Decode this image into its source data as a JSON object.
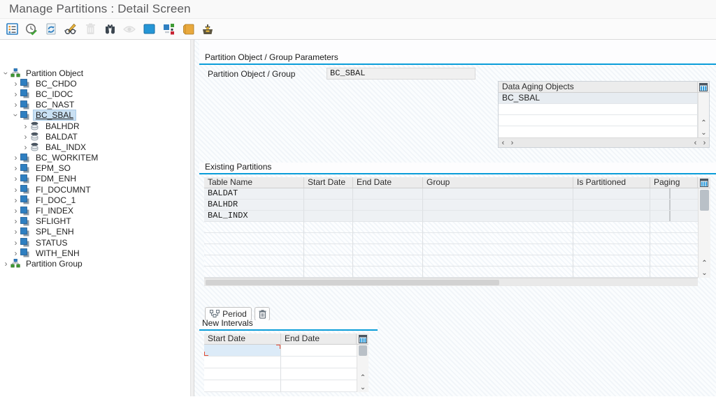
{
  "window": {
    "title": "Manage Partitions : Detail Screen"
  },
  "toolbar": {
    "icons": [
      "detail-list",
      "schedule-check",
      "refresh",
      "display-change",
      "delete",
      "find",
      "preview",
      "block",
      "legend",
      "note",
      "import"
    ]
  },
  "tree": {
    "items": [
      {
        "label": "Partition Object",
        "level": 0,
        "expanded": true
      },
      {
        "label": "BC_CHDO",
        "level": 1
      },
      {
        "label": "BC_IDOC",
        "level": 1
      },
      {
        "label": "BC_NAST",
        "level": 1
      },
      {
        "label": "BC_SBAL",
        "level": 1,
        "expanded": true,
        "selected": true
      },
      {
        "label": "BALHDR",
        "level": 2
      },
      {
        "label": "BALDAT",
        "level": 2
      },
      {
        "label": "BAL_INDX",
        "level": 2
      },
      {
        "label": "BC_WORKITEM",
        "level": 1
      },
      {
        "label": "EPM_SO",
        "level": 1
      },
      {
        "label": "FDM_ENH",
        "level": 1
      },
      {
        "label": "FI_DOCUMNT",
        "level": 1
      },
      {
        "label": "FI_DOC_1",
        "level": 1
      },
      {
        "label": "FI_INDEX",
        "level": 1
      },
      {
        "label": "SFLIGHT",
        "level": 1
      },
      {
        "label": "SPL_ENH",
        "level": 1
      },
      {
        "label": "STATUS",
        "level": 1
      },
      {
        "label": "WITH_ENH",
        "level": 1
      },
      {
        "label": "Partition Group",
        "level": 0,
        "expanded": false
      }
    ]
  },
  "params": {
    "section_title": "Partition Object / Group Parameters",
    "field_label": "Partition Object / Group",
    "field_value": "BC_SBAL",
    "aging": {
      "title": "Data Aging Objects",
      "rows": [
        "BC_SBAL",
        "",
        "",
        ""
      ]
    }
  },
  "partitions": {
    "section_title": "Existing Partitions",
    "columns": [
      "Table Name",
      "Start Date",
      "End Date",
      "Group",
      "Is Partitioned",
      "Paging"
    ],
    "rows": [
      {
        "table_name": "BALDAT",
        "start_date": "",
        "end_date": "",
        "group": "",
        "is_partitioned": true,
        "paging": false
      },
      {
        "table_name": "BALHDR",
        "start_date": "",
        "end_date": "",
        "group": "",
        "is_partitioned": true,
        "paging": false
      },
      {
        "table_name": "BAL_INDX",
        "start_date": "",
        "end_date": "",
        "group": "",
        "is_partitioned": true,
        "paging": false
      }
    ],
    "empty_row_count": 5
  },
  "intervals": {
    "period_button_label": "Period",
    "section_title": "New Intervals",
    "columns": [
      "Start Date",
      "End Date"
    ],
    "rows": [
      {
        "start_date": "",
        "end_date": "",
        "focused": true
      },
      {
        "start_date": "",
        "end_date": ""
      },
      {
        "start_date": "",
        "end_date": ""
      },
      {
        "start_date": "",
        "end_date": ""
      }
    ]
  },
  "colors": {
    "accent_blue": "#0a9dd9",
    "status_red": "#c9202b",
    "tree_selection": "#c9e0f3",
    "grid_icon_blue": "#2e9ad9"
  }
}
